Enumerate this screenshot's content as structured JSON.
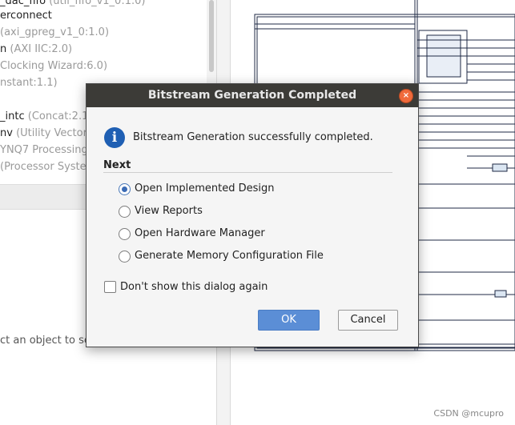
{
  "left_panel": {
    "tree_items": [
      {
        "name": "_dac_fifo",
        "detail": "(util_fifo_v1_0:1.0)"
      },
      {
        "name": "erconnect",
        "detail": ""
      },
      {
        "name": "",
        "detail": "(axi_gpreg_v1_0:1.0)"
      },
      {
        "name": "n",
        "detail": "(AXI IIC:2.0)"
      },
      {
        "name": "",
        "detail": "Clocking Wizard:6.0)"
      },
      {
        "name": "",
        "detail": "nstant:1.1)"
      },
      {
        "name": "",
        "detail": ""
      },
      {
        "name": "_intc",
        "detail": "(Concat:2.1)"
      },
      {
        "name": "nv",
        "detail": "(Utility Vector L"
      },
      {
        "name": "",
        "detail": "YNQ7 Processing"
      },
      {
        "name": "",
        "detail": "(Processor Syste"
      }
    ],
    "properties_message": "ct an object to se"
  },
  "dialog": {
    "title": "Bitstream Generation Completed",
    "close_icon": "×",
    "info_icon": "i",
    "message": "Bitstream Generation successfully completed.",
    "section_heading": "Next",
    "options": [
      {
        "label": "Open Implemented Design",
        "selected": true
      },
      {
        "label": "View Reports",
        "selected": false
      },
      {
        "label": "Open Hardware Manager",
        "selected": false
      },
      {
        "label": "Generate Memory Configuration File",
        "selected": false
      }
    ],
    "checkbox_label": "Don't show this dialog again",
    "checkbox_checked": false,
    "ok_label": "OK",
    "cancel_label": "Cancel"
  },
  "watermark": "CSDN @mcupro",
  "colors": {
    "title_bar": "#3c3b37",
    "ok_button": "#5b8ed6",
    "info_icon": "#1f5fb3",
    "close_button": "#f06a3b"
  }
}
